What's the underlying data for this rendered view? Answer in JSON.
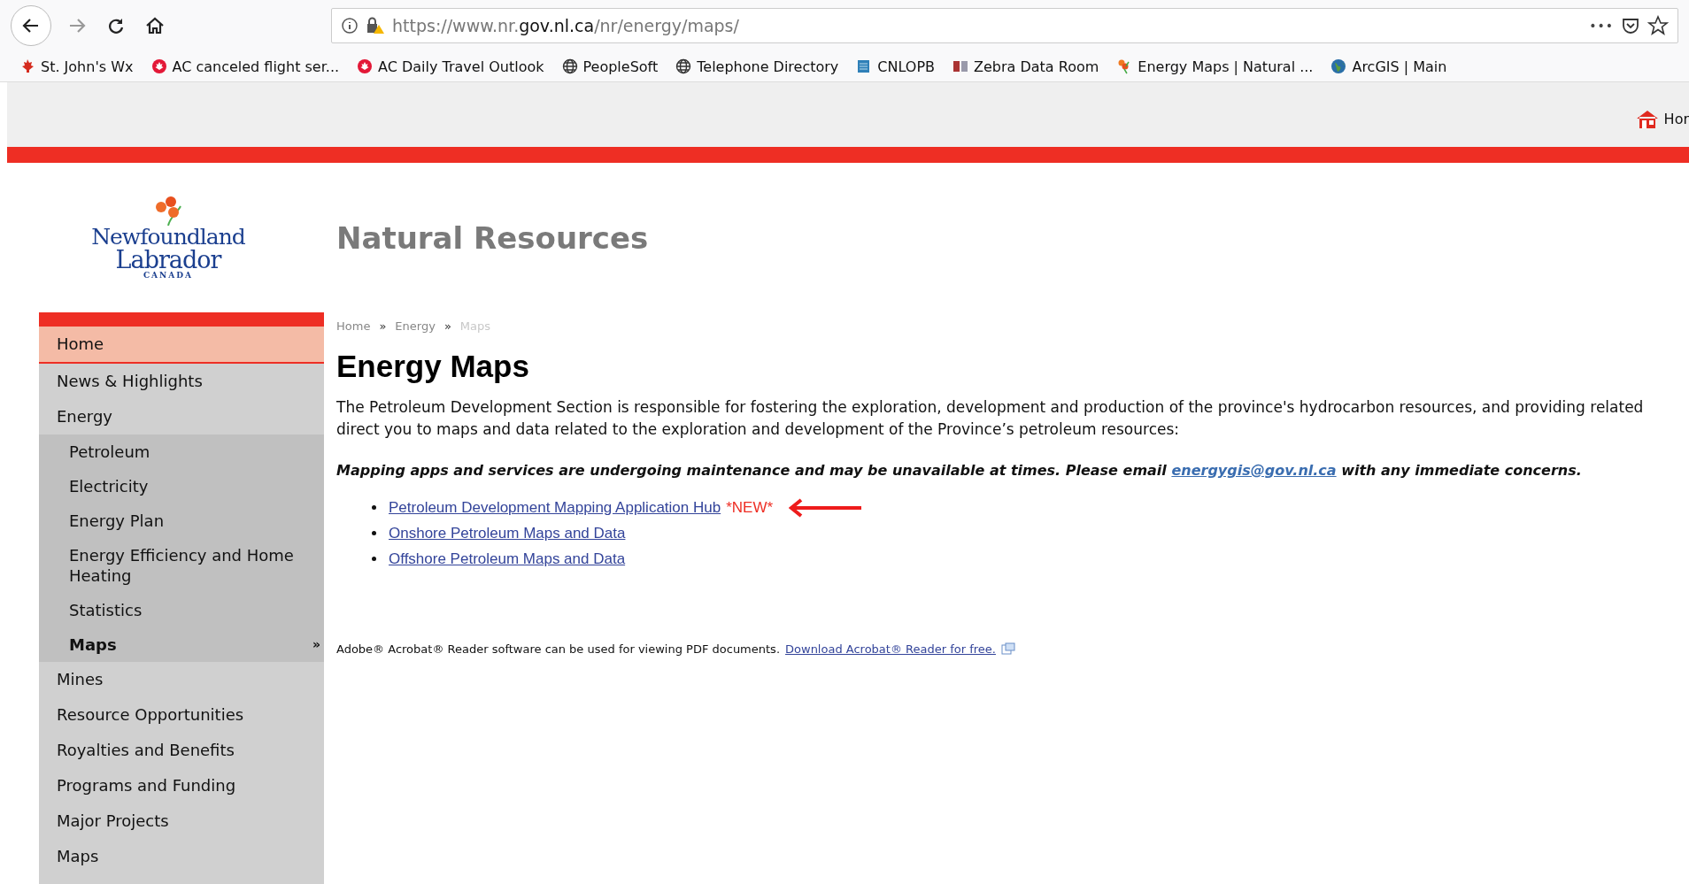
{
  "browser": {
    "url_prefix": "https://www.nr.",
    "url_domain": "gov.nl.ca",
    "url_path": "/nr/energy/maps/",
    "overflow": "•••"
  },
  "bookmarks": [
    {
      "kind": "leaf",
      "label": "St. John's Wx"
    },
    {
      "kind": "roundel",
      "label": "AC canceled flight ser..."
    },
    {
      "kind": "roundel",
      "label": "AC Daily Travel Outlook"
    },
    {
      "kind": "globe",
      "label": "PeopleSoft"
    },
    {
      "kind": "globe",
      "label": "Telephone Directory"
    },
    {
      "kind": "document",
      "label": "CNLOPB"
    },
    {
      "kind": "grid",
      "label": "Zebra Data Room"
    },
    {
      "kind": "flower",
      "label": "Energy Maps | Natural ..."
    },
    {
      "kind": "earth",
      "label": "ArcGIS | Main"
    }
  ],
  "header": {
    "home_link": "Hor"
  },
  "logo": {
    "lines": [
      "Newfoundland",
      "Labrador",
      "CANADA"
    ]
  },
  "site_title": "Natural Resources",
  "sidebar": {
    "items": [
      {
        "label": "Home",
        "selected": true
      },
      {
        "label": "News & Highlights",
        "selected": false
      },
      {
        "label": "Energy",
        "selected": false,
        "children": [
          {
            "label": "Petroleum",
            "selected": false
          },
          {
            "label": "Electricity",
            "selected": false
          },
          {
            "label": "Energy Plan",
            "selected": false
          },
          {
            "label": "Energy Efficiency and Home Heating",
            "selected": false
          },
          {
            "label": "Statistics",
            "selected": false
          },
          {
            "label": "Maps",
            "selected": true,
            "marker": "»"
          }
        ]
      },
      {
        "label": "Mines",
        "selected": false
      },
      {
        "label": "Resource Opportunities",
        "selected": false
      },
      {
        "label": "Royalties and Benefits",
        "selected": false
      },
      {
        "label": "Programs and Funding",
        "selected": false
      },
      {
        "label": "Major Projects",
        "selected": false
      },
      {
        "label": "Maps",
        "selected": false
      }
    ]
  },
  "breadcrumb": {
    "separator": "»",
    "items": [
      "Home",
      "Energy",
      "Maps"
    ]
  },
  "heading": "Energy Maps",
  "intro_lines": [
    "The Petroleum Development Section is responsible for fostering the exploration, development and production of the province's hydrocarbon resources, and providing related",
    "direct you to maps and data related to the exploration and development of the Province’s petroleum resources:"
  ],
  "notice": {
    "before": "Mapping apps and services are undergoing maintenance and may be unavailable at times. Please email ",
    "link": "energygis@gov.nl.ca",
    "after": " with any immediate concerns."
  },
  "links": [
    {
      "label": "Petroleum Development Mapping Application Hub",
      "badge": "*NEW*",
      "pointed": true
    },
    {
      "label": "Onshore Petroleum Maps and Data",
      "pointed": false
    },
    {
      "label": "Offshore Petroleum Maps and Data",
      "pointed": false
    }
  ],
  "footer": {
    "text": "Adobe® Acrobat® Reader software can be used for viewing PDF documents.",
    "link": "Download Acrobat® Reader for free."
  }
}
